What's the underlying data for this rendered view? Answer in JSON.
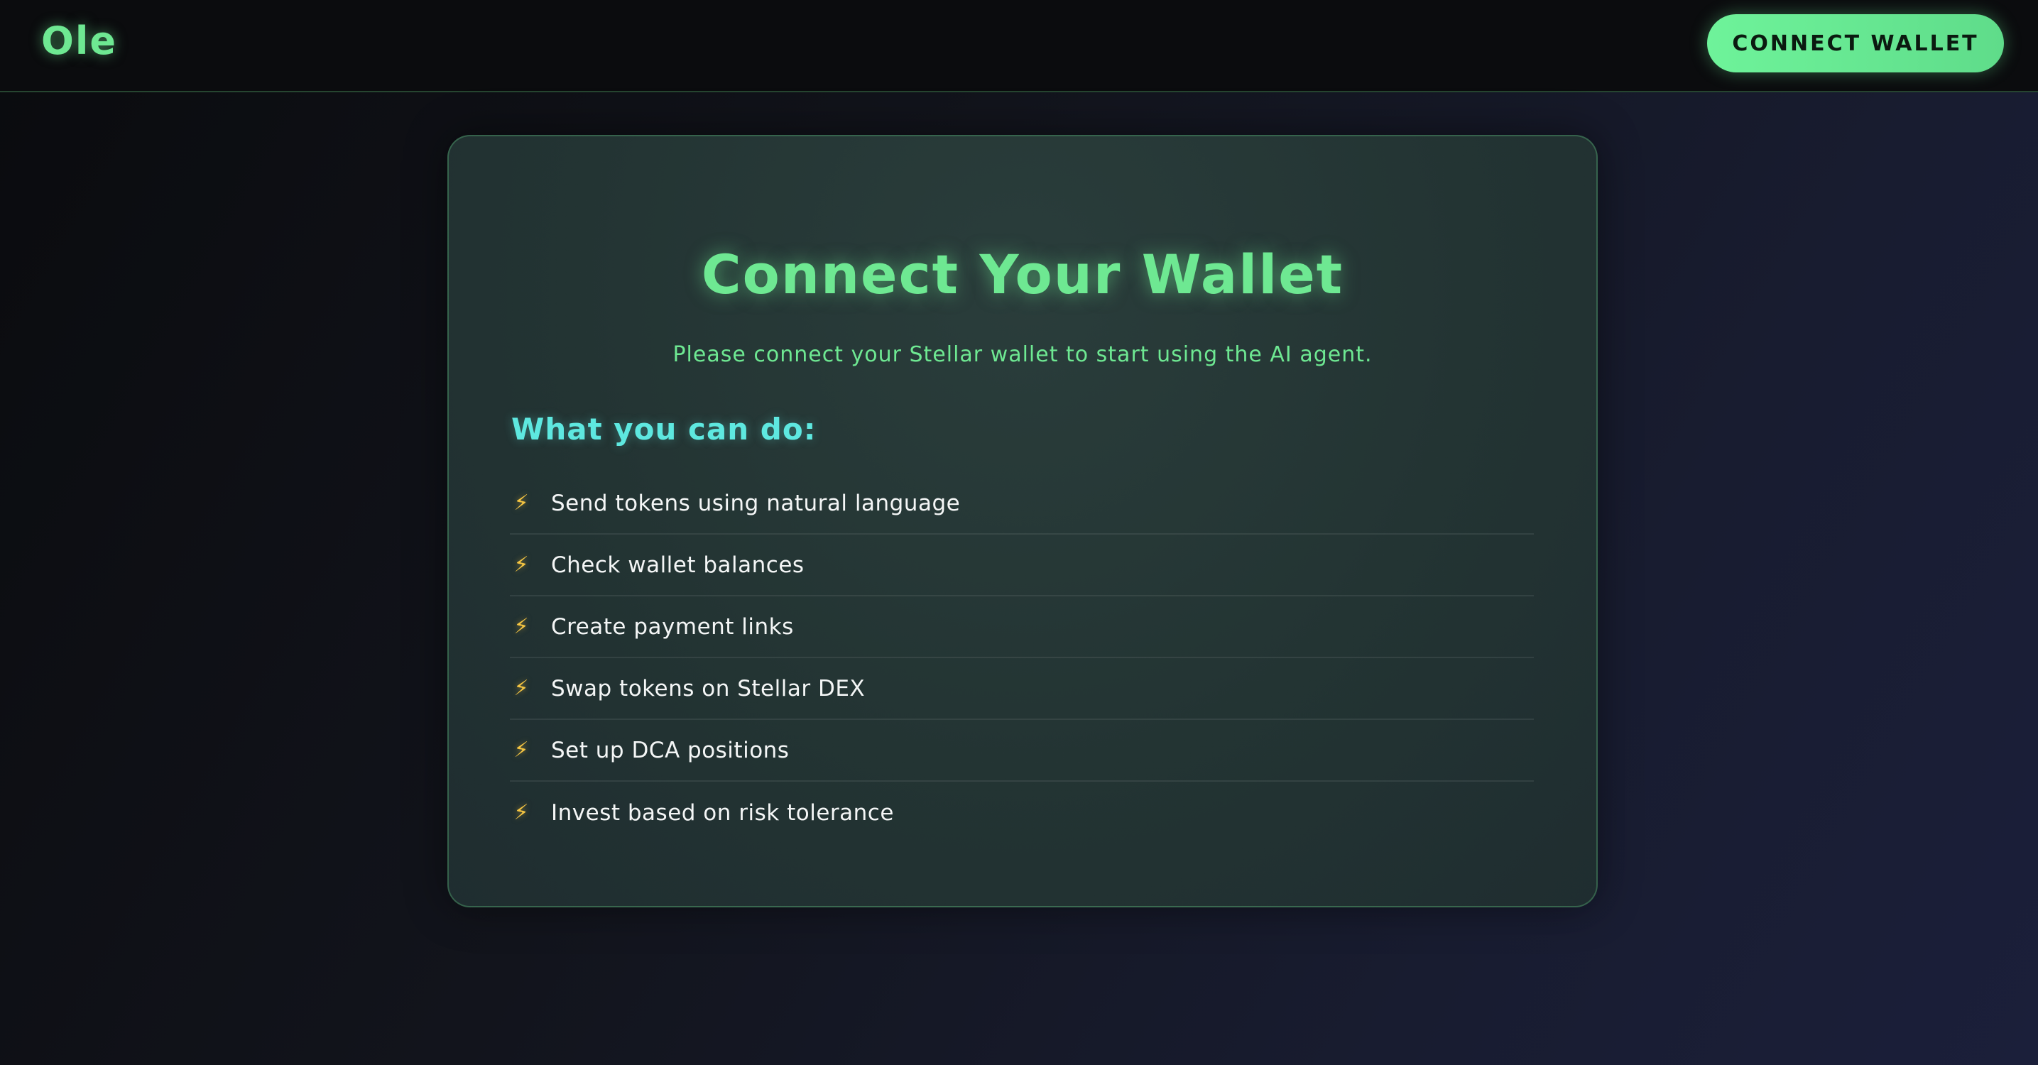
{
  "header": {
    "logo": "Ole",
    "connect_label": "CONNECT WALLET"
  },
  "card": {
    "title": "Connect Your Wallet",
    "subtitle": "Please connect your Stellar wallet to start using the AI agent.",
    "section_heading": "What you can do:",
    "features": [
      {
        "icon": "⚡",
        "label": "Send tokens using natural language"
      },
      {
        "icon": "⚡",
        "label": "Check wallet balances"
      },
      {
        "icon": "⚡",
        "label": "Create payment links"
      },
      {
        "icon": "⚡",
        "label": "Swap tokens on Stellar DEX"
      },
      {
        "icon": "⚡",
        "label": "Set up DCA positions"
      },
      {
        "icon": "⚡",
        "label": "Invest based on risk tolerance"
      }
    ]
  },
  "colors": {
    "accent": "#6ee892",
    "heading_cyan": "#5ee8e0",
    "bolt": "#f5c542"
  }
}
